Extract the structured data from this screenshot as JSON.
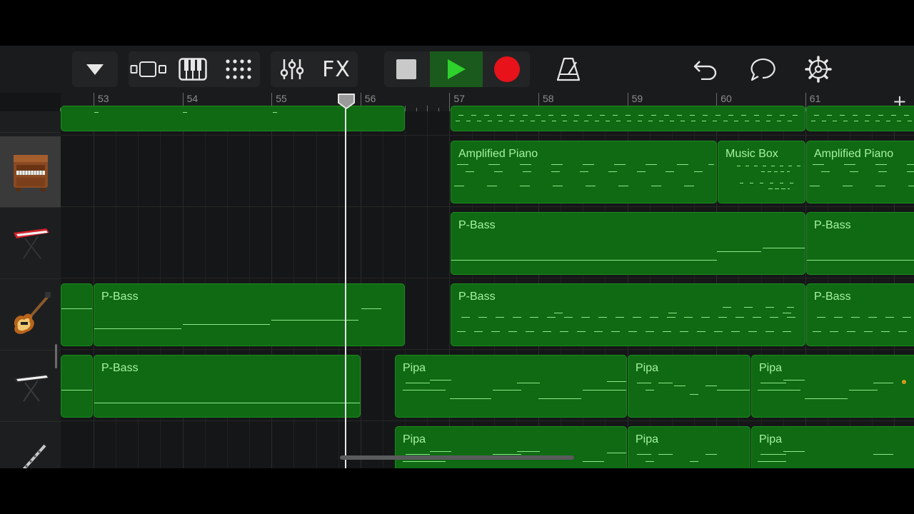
{
  "toolbar": {
    "fx_label": "FX",
    "icons": [
      "triangle-down-icon",
      "tracks-view-icon",
      "keyboard-icon",
      "grid-icon",
      "mixer-icon",
      "fx-icon",
      "stop-icon",
      "play-icon",
      "record-icon",
      "metronome-icon",
      "undo-icon",
      "loop-icon",
      "settings-icon"
    ]
  },
  "ruler": {
    "bars": [
      "53",
      "54",
      "55",
      "56",
      "57",
      "58",
      "59",
      "60",
      "61"
    ],
    "add_label": "+"
  },
  "tracks": {
    "instruments": [
      "synth-instrument",
      "upright-piano",
      "red-keyboard",
      "electric-bass",
      "stand-keyboard",
      "flute"
    ],
    "regions": [
      {
        "name": "Amplified Piano"
      },
      {
        "name": "Music Box"
      },
      {
        "name": "Amplified Piano"
      },
      {
        "name": "P-Bass"
      },
      {
        "name": "P-Bass"
      },
      {
        "name": "P-Bass"
      },
      {
        "name": "P-Bass"
      },
      {
        "name": "P-Bass"
      },
      {
        "name": "P-Bass"
      },
      {
        "name": "Pipa"
      },
      {
        "name": "Pipa"
      },
      {
        "name": "Pipa"
      },
      {
        "name": "Pipa"
      },
      {
        "name": "Pipa"
      },
      {
        "name": "Pipa"
      }
    ]
  },
  "colors": {
    "region_fill": "#0f6a13",
    "region_text": "#a6f2a0",
    "record": "#e8121a",
    "play": "#2fd12c"
  }
}
